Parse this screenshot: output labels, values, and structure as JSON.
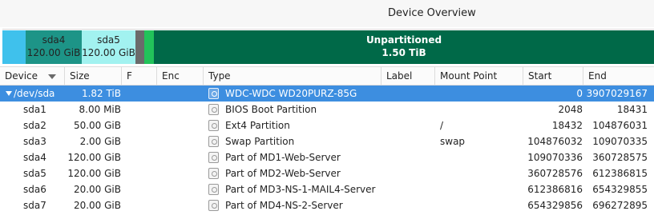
{
  "window": {
    "title": "Device Overview"
  },
  "partition_bar": {
    "segments": [
      {
        "name": "",
        "size": "",
        "color": "#3fc1ec"
      },
      {
        "name": "sda4",
        "size": "120.00 GiB",
        "color": "#1d9487"
      },
      {
        "name": "sda5",
        "size": "120.00 GiB",
        "color": "#a2f2f0"
      },
      {
        "name": "",
        "size": "",
        "color": "#6b6b6b"
      },
      {
        "name": "",
        "size": "",
        "color": "#22c35a"
      },
      {
        "name": "Unpartitioned",
        "size": "1.50 TiB",
        "color": "#006948"
      }
    ]
  },
  "table": {
    "headers": {
      "device": "Device",
      "size": "Size",
      "flags": "F",
      "enc": "Enc",
      "type": "Type",
      "label": "Label",
      "mount": "Mount Point",
      "start": "Start",
      "end": "End"
    },
    "rows": [
      {
        "device": "/dev/sda",
        "size": "1.82 TiB",
        "type": "WDC-WDC WD20PURZ-85G",
        "mount": "",
        "start": "0",
        "end": "3907029167"
      },
      {
        "device": "sda1",
        "size": "8.00 MiB",
        "type": "BIOS Boot Partition",
        "mount": "",
        "start": "2048",
        "end": "18431"
      },
      {
        "device": "sda2",
        "size": "50.00 GiB",
        "type": "Ext4 Partition",
        "mount": "/",
        "start": "18432",
        "end": "104876031"
      },
      {
        "device": "sda3",
        "size": "2.00 GiB",
        "type": "Swap Partition",
        "mount": "swap",
        "start": "104876032",
        "end": "109070335"
      },
      {
        "device": "sda4",
        "size": "120.00 GiB",
        "type": "Part of MD1-Web-Server",
        "mount": "",
        "start": "109070336",
        "end": "360728575"
      },
      {
        "device": "sda5",
        "size": "120.00 GiB",
        "type": "Part of MD2-Web-Server",
        "mount": "",
        "start": "360728576",
        "end": "612386815"
      },
      {
        "device": "sda6",
        "size": "20.00 GiB",
        "type": "Part of MD3-NS-1-MAIL4-Server",
        "mount": "",
        "start": "612386816",
        "end": "654329855"
      },
      {
        "device": "sda7",
        "size": "20.00 GiB",
        "type": "Part of MD4-NS-2-Server",
        "mount": "",
        "start": "654329856",
        "end": "696272895"
      }
    ]
  }
}
